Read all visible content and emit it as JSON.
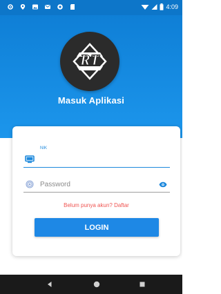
{
  "status_bar": {
    "time": "4:09",
    "left_icons": [
      "settings-icon",
      "location-icon",
      "image-icon",
      "message-icon",
      "sync-icon",
      "sd-card-icon"
    ],
    "right_icons": [
      "wifi-icon",
      "signal-icon",
      "battery-icon"
    ]
  },
  "header": {
    "logo_text": "RT",
    "title": "Masuk Aplikasi",
    "background": "#1a8ae6"
  },
  "login_form": {
    "nik_label": "NIK",
    "nik_value": "",
    "password_placeholder": "Password",
    "register_link": "Belum punya akun? Daftar",
    "login_button": "LOGIN"
  },
  "colors": {
    "accent": "#1e88e5",
    "link": "#ef5350",
    "navbar": "#1a1a1a"
  },
  "nav_bar": {
    "items": [
      "back-icon",
      "home-icon",
      "recents-icon"
    ]
  }
}
